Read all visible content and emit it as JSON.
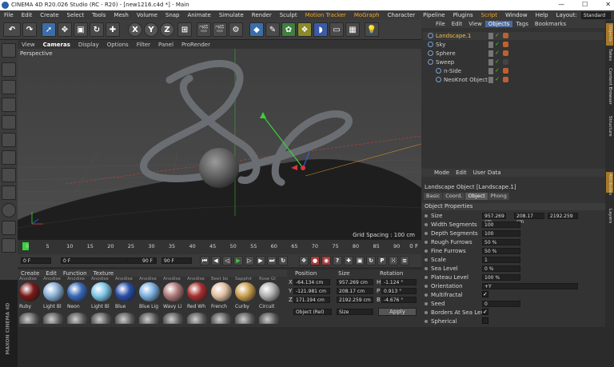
{
  "title": "CINEMA 4D R20.026 Studio (RC - R20) - [new1216.c4d *] - Main",
  "menu": [
    "File",
    "Edit",
    "Create",
    "Select",
    "Tools",
    "Mesh",
    "Volume",
    "Snap",
    "Animate",
    "Simulate",
    "Render",
    "Sculpt",
    "Motion Tracker",
    "MoGraph",
    "Character",
    "Pipeline",
    "Plugins",
    "Script",
    "Window",
    "Help"
  ],
  "layout_label": "Layout:",
  "layout_value": "Standard",
  "viewport": {
    "menu": [
      "View",
      "Cameras",
      "Display",
      "Options",
      "Filter",
      "Panel",
      "ProRender"
    ],
    "perspective": "Perspective",
    "grid_spacing": "Grid Spacing : 100 cm"
  },
  "timeline": {
    "ticks": [
      "0",
      "5",
      "10",
      "15",
      "20",
      "25",
      "30",
      "35",
      "40",
      "45",
      "50",
      "55",
      "60",
      "65",
      "70",
      "75",
      "80",
      "85",
      "90"
    ],
    "end_label": "0 F"
  },
  "transport": {
    "start": "0 F",
    "current": "0 F",
    "end": "90 F",
    "max": "90 F"
  },
  "materials": {
    "menu": [
      "Create",
      "Edit",
      "Function",
      "Texture"
    ],
    "header": [
      "Anodise",
      "Anodise",
      "Anodise",
      "Anodise",
      "Anodise",
      "Anodise",
      "Anodise",
      "Anodise",
      "Beet bo",
      "Sapphir",
      "Rose Gl"
    ],
    "items": [
      "Ruby",
      "Light Bl",
      "Neon",
      "Light Bl",
      "Blue",
      "Blue Lig",
      "Wavy Li",
      "Red Wh",
      "French",
      "Curby",
      "Circuit"
    ]
  },
  "coords": {
    "headers": [
      "Position",
      "Size",
      "Rotation"
    ],
    "rows": [
      {
        "axis": "X",
        "pos": "-64.134 cm",
        "size": "957.269 cm",
        "rl": "H",
        "rot": "-1.124 °"
      },
      {
        "axis": "Y",
        "pos": "-121.981 cm",
        "size": "208.17 cm",
        "rl": "P",
        "rot": "0.913 °"
      },
      {
        "axis": "Z",
        "pos": "171.194 cm",
        "size": "2192.259 cm",
        "rl": "B",
        "rot": "-4.676 °"
      }
    ],
    "mode": "Object (Rel)",
    "sizemode": "Size",
    "apply": "Apply"
  },
  "objects": {
    "menu": [
      "File",
      "Edit",
      "View",
      "Objects",
      "Tags",
      "Bookmarks"
    ],
    "items": [
      {
        "name": "Landscape.1",
        "indent": 0,
        "color": "#f0c040"
      },
      {
        "name": "Sky",
        "indent": 0,
        "color": "#cfcfcf"
      },
      {
        "name": "Sphere",
        "indent": 0,
        "color": "#cfcfcf"
      },
      {
        "name": "Sweep",
        "indent": 0,
        "color": "#cfcfcf"
      },
      {
        "name": "n-Side",
        "indent": 1,
        "color": "#cfcfcf"
      },
      {
        "name": "NeoKnot Object",
        "indent": 1,
        "color": "#cfcfcf"
      }
    ]
  },
  "attributes": {
    "menu": [
      "Mode",
      "Edit",
      "User Data"
    ],
    "object_title": "Landscape Object [Landscape.1]",
    "tabs": [
      "Basic",
      "Coord.",
      "Object",
      "Phong"
    ],
    "section": "Object Properties",
    "props": [
      {
        "label": "Size",
        "value": "957.269 cm",
        "v2": "208.17 cm",
        "v3": "2192.259"
      },
      {
        "label": "Width Segments",
        "value": "100"
      },
      {
        "label": "Depth Segments",
        "value": "100"
      },
      {
        "label": "Rough Furrows",
        "value": "50 %"
      },
      {
        "label": "Fine Furrows",
        "value": "50 %"
      },
      {
        "label": "Scale",
        "value": "1"
      },
      {
        "label": "Sea Level",
        "value": "0 %"
      },
      {
        "label": "Plateau Level",
        "value": "100 %"
      },
      {
        "label": "Orientation",
        "value": "+Y"
      },
      {
        "label": "Multifractal",
        "value": "✓"
      },
      {
        "label": "Seed",
        "value": "0"
      },
      {
        "label": "Borders At Sea Level",
        "value": "✓"
      },
      {
        "label": "Spherical",
        "value": ""
      }
    ]
  },
  "right_tabs": [
    "Objects",
    "Takes",
    "Content Browser",
    "Structure",
    "Attributes",
    "Layers"
  ],
  "brand": "MAXON CINEMA 4D"
}
